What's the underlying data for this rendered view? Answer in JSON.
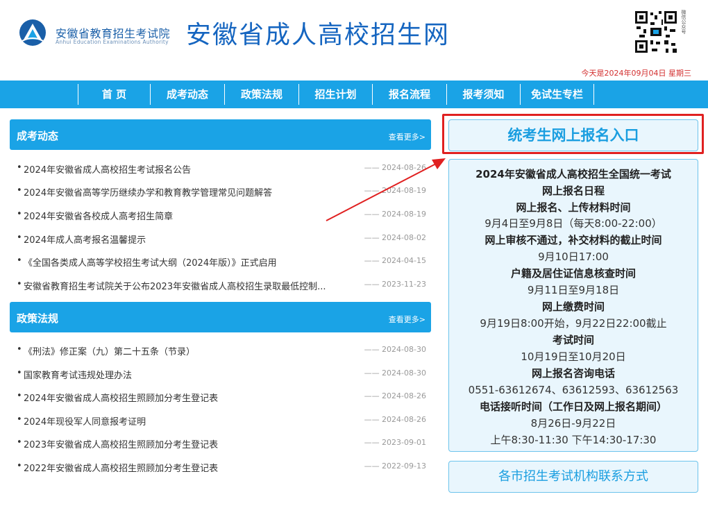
{
  "header": {
    "org_name_cn": "安徽省教育招生考试院",
    "org_name_en": "Anhui Education Examinations Authority",
    "site_title": "安徽省成人高校招生网",
    "qr_label": "微信公众号",
    "date_text": "今天是2024年09月04日 星期三"
  },
  "nav": {
    "items": [
      "首 页",
      "成考动态",
      "政策法规",
      "招生计划",
      "报名流程",
      "报考须知",
      "免试生专栏"
    ]
  },
  "news": {
    "title": "成考动态",
    "more": "查看更多>",
    "items": [
      {
        "title": "2024年安徽省成人高校招生考试报名公告",
        "date": "—— 2024-08-26"
      },
      {
        "title": "2024年安徽省高等学历继续办学和教育教学管理常见问题解答",
        "date": "—— 2024-08-19"
      },
      {
        "title": "2024年安徽省各校成人高考招生简章",
        "date": "—— 2024-08-19"
      },
      {
        "title": "2024年成人高考报名温馨提示",
        "date": "—— 2024-08-02"
      },
      {
        "title": "《全国各类成人高等学校招生考试大纲（2024年版）》正式启用",
        "date": "—— 2024-04-15"
      },
      {
        "title": "安徽省教育招生考试院关于公布2023年安徽省成人高校招生录取最低控制...",
        "date": "—— 2023-11-23"
      }
    ]
  },
  "policy": {
    "title": "政策法规",
    "more": "查看更多>",
    "items": [
      {
        "title": "《刑法》修正案（九）第二十五条（节录）",
        "date": "—— 2024-08-30"
      },
      {
        "title": "国家教育考试违规处理办法",
        "date": "—— 2024-08-30"
      },
      {
        "title": "2024年安徽省成人高校招生照顾加分考生登记表",
        "date": "—— 2024-08-26"
      },
      {
        "title": "2024年现役军人同意报考证明",
        "date": "—— 2024-08-26"
      },
      {
        "title": "2023年安徽省成人高校招生照顾加分考生登记表",
        "date": "—— 2023-09-01"
      },
      {
        "title": "2022年安徽省成人高校招生照顾加分考生登记表",
        "date": "—— 2022-09-13"
      }
    ]
  },
  "sidebar": {
    "register_label": "统考生网上报名入口",
    "schedule": [
      {
        "text": "2024年安徽省成人高校招生全国统一考试",
        "bold": true
      },
      {
        "text": "网上报名日程",
        "bold": true
      },
      {
        "text": "网上报名、上传材料时间",
        "bold": true
      },
      {
        "text": "9月4日至9月8日（每天8:00-22:00）",
        "bold": false
      },
      {
        "text": "网上审核不通过，补交材料的截止时间",
        "bold": true
      },
      {
        "text": "9月10日17:00",
        "bold": false
      },
      {
        "text": "户籍及居住证信息核查时间",
        "bold": true
      },
      {
        "text": "9月11日至9月18日",
        "bold": false
      },
      {
        "text": "网上缴费时间",
        "bold": true
      },
      {
        "text": "9月19日8:00开始，9月22日22:00截止",
        "bold": false
      },
      {
        "text": "考试时间",
        "bold": true
      },
      {
        "text": "10月19日至10月20日",
        "bold": false
      },
      {
        "text": "网上报名咨询电话",
        "bold": true
      },
      {
        "text": "0551-63612674、63612593、63612563",
        "bold": false
      },
      {
        "text": "电话接听时间（工作日及网上报名期间）",
        "bold": true
      },
      {
        "text": "8月26日-9月22日",
        "bold": false
      },
      {
        "text": "上午8:30-11:30 下午14:30-17:30",
        "bold": false
      }
    ],
    "contact_label": "各市招生考试机构联系方式"
  },
  "colors": {
    "nav_bg": "#1aa3e6",
    "title_blue": "#1565c0",
    "highlight_red": "#e02020",
    "panel_bg": "#e9f6fd"
  }
}
